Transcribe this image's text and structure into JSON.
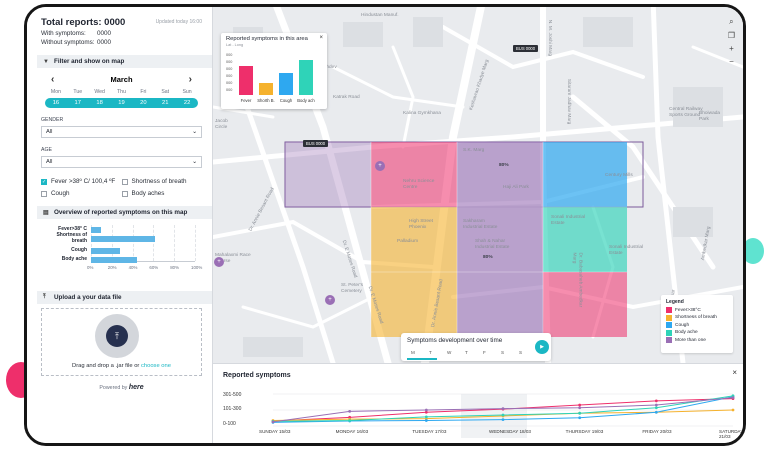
{
  "sidebar": {
    "total_reports": "Total reports: 0000",
    "updated": "Updated today 16:00",
    "with_symptoms_label": "With symptoms:",
    "with_symptoms_value": "0000",
    "without_symptoms_label": "Without symptoms:",
    "without_symptoms_value": "0000",
    "filter_title": "Filter  and  show on map",
    "month": "March",
    "weekdays": [
      "Mon",
      "Tue",
      "Wed",
      "Thu",
      "Fri",
      "Sat",
      "Sun"
    ],
    "dates": [
      "16",
      "17",
      "18",
      "19",
      "20",
      "21",
      "22"
    ],
    "gender_label": "GENDER",
    "gender_value": "All",
    "age_label": "AGE",
    "age_value": "All",
    "symptoms": [
      {
        "label": "Fever >38º C/ 100,4 ºF",
        "checked": true
      },
      {
        "label": "Shortness of breath",
        "checked": false
      },
      {
        "label": "Cough",
        "checked": false
      },
      {
        "label": "Body aches",
        "checked": false
      }
    ],
    "overview_title": "Overview of reported symptoms on this map",
    "upload_title": "Upload a your data file",
    "upload_text": "Drag and drop a .jar file or",
    "upload_link": "choose one",
    "powered_by": "Powered by",
    "powered_brand": "here"
  },
  "overview_chart": {
    "type": "bar",
    "categories": [
      "Fever>38° C",
      "Shortness of breath",
      "Cough",
      "Body ache"
    ],
    "values": [
      10,
      62,
      28,
      44
    ],
    "ticks": [
      "0%",
      "20%",
      "40%",
      "60%",
      "80%",
      "100%"
    ],
    "xlim": [
      0,
      100
    ]
  },
  "map": {
    "bus_label_1": "BUS 0000",
    "bus_label_2": "BUS 0000",
    "cell_pct_1": "80%",
    "cell_pct_2": "80%",
    "street_labels": [
      "S.K. Marg",
      "Dr. E Moses Road",
      "Dr. E Moses Road",
      "Dr. Annie Besant Road",
      "Dr. Annie Besant Road",
      "Keshavrao Khadye Marg",
      "Haji Ali Park",
      "Dr. Babasaheb Ambedkar Marg",
      "N. M. Joshi Marg",
      "Sitaram Jadhav Marg",
      "Ambedkar Marg",
      "Katrak Road",
      "Dr. Babasaheb Ambedkar Marg"
    ],
    "place_labels": [
      "Nehru Science Centre",
      "Kalina Gymkhana",
      "High Street Phoenix",
      "Palladium",
      "Sakharam Industrial Estate",
      "Sonali Industrial Estate",
      "Sonali Industrial Estate",
      "Shah & Nahar Industrial Estate",
      "Central Railway Sports Ground",
      "Bhoiwada Park",
      "St. Peter's Cemetery",
      "Hindustan Manuf.",
      "Jacob Circle",
      "Ghoddod Sukhdev Nagar",
      "Mahalaxmi Race Course",
      "Century Mills"
    ]
  },
  "popup": {
    "title": "Reported symptoms in this area",
    "subtitle": "Lat - Long",
    "yticks": [
      "000",
      "000",
      "000",
      "000",
      "000",
      "000"
    ],
    "chart_data": {
      "type": "bar",
      "categories": [
        "Fever",
        "Shorth B.",
        "Cough",
        "Body ach"
      ],
      "values": [
        58,
        25,
        45,
        70
      ],
      "colors": [
        "#ee2f6b",
        "#f5b22e",
        "#2ea8f0",
        "#2fd3b8"
      ]
    }
  },
  "legend": {
    "title": "Legend",
    "items": [
      {
        "label": "Fever>38°C",
        "color": "#ee2f6b"
      },
      {
        "label": "Shortness of breath",
        "color": "#f5b22e"
      },
      {
        "label": "Cough",
        "color": "#2ea8f0"
      },
      {
        "label": "Body ache",
        "color": "#2fd3b8"
      },
      {
        "label": "More than one",
        "color": "#9a6fb5"
      }
    ]
  },
  "development": {
    "title": "Symptoms development over time",
    "weekdays": [
      "M",
      "T",
      "W",
      "T",
      "F",
      "S",
      "S"
    ]
  },
  "bottom": {
    "title": "Reported symptoms",
    "chart_data": {
      "type": "line",
      "x": [
        "SUNDAY 15/03",
        "MONDAY 16/03",
        "TUESDAY 17/03",
        "WEDNESDAY 18/03",
        "THURSDAY 19/03",
        "FRIDAY 20/03",
        "SATURDAY 21/03"
      ],
      "y_ticks": [
        "301-500",
        "101-300",
        "0-100"
      ],
      "highlighted": "WEDNESDAY 18/03",
      "series": [
        {
          "color": "#ee2f6b",
          "values": [
            55,
            95,
            150,
            185,
            230,
            275,
            300
          ]
        },
        {
          "color": "#f5b22e",
          "values": [
            60,
            75,
            80,
            110,
            140,
            150,
            175
          ]
        },
        {
          "color": "#2ea8f0",
          "values": [
            40,
            55,
            60,
            70,
            90,
            150,
            320
          ]
        },
        {
          "color": "#2fd3b8",
          "values": [
            50,
            60,
            100,
            120,
            140,
            200,
            330
          ]
        },
        {
          "color": "#9a6fb5",
          "values": [
            45,
            160,
            175,
            190,
            200,
            230,
            310
          ]
        }
      ]
    }
  }
}
